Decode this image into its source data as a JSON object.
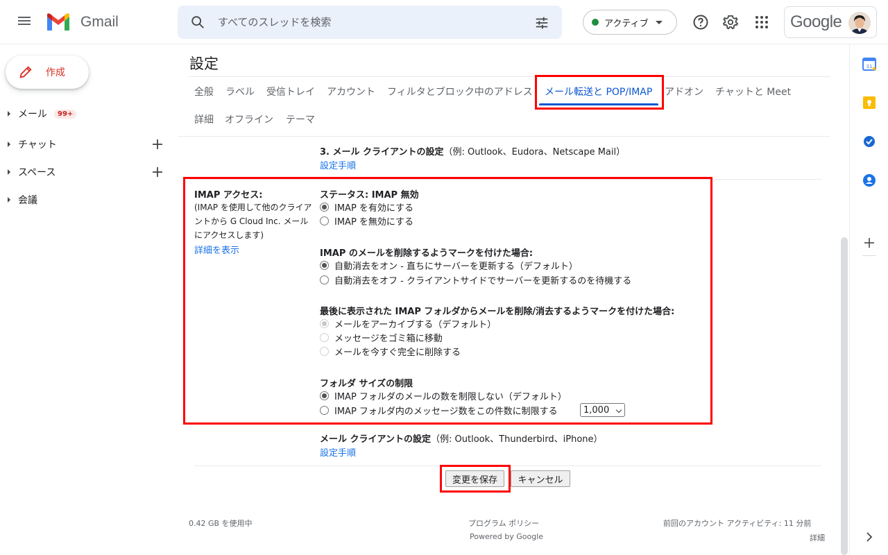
{
  "header": {
    "app_name": "Gmail",
    "search_placeholder": "すべてのスレッドを検索",
    "status_label": "アクティブ",
    "account_brand": "Google"
  },
  "nav": {
    "compose_label": "作成",
    "items": [
      {
        "label": "メール",
        "badge": "99+"
      },
      {
        "label": "チャット"
      },
      {
        "label": "スペース"
      },
      {
        "label": "会議"
      }
    ]
  },
  "settings": {
    "title": "設定",
    "tabs_row1": [
      "全般",
      "ラベル",
      "受信トレイ",
      "アカウント",
      "フィルタとブロック中のアドレス",
      "メール転送と POP/IMAP",
      "アドオン",
      "チャットと Meet"
    ],
    "tabs_row2": [
      "詳細",
      "オフライン",
      "テーマ"
    ],
    "active_tab": "メール転送と POP/IMAP",
    "client_setup": {
      "title_bold": "3. メール クライアントの設定",
      "title_rest": "（例: Outlook、Eudora、Netscape Mail）",
      "link": "設定手順"
    },
    "imap": {
      "label": "IMAP アクセス:",
      "description": "(IMAP を使用して他のクライアントから G Cloud Inc. メール にアクセスします)",
      "details_link": "詳細を表示",
      "status_title": "ステータス: IMAP 無効",
      "status_options": [
        "IMAP を有効にする",
        "IMAP を無効にする"
      ],
      "delete_title": "IMAP のメールを削除するようマークを付けた場合:",
      "delete_options": [
        "自動消去をオン - 直ちにサーバーを更新する（デフォルト）",
        "自動消去をオフ - クライアントサイドでサーバーを更新するのを待機する"
      ],
      "expunge_title": "最後に表示された IMAP フォルダからメールを削除/消去するようマークを付けた場合:",
      "expunge_options": [
        "メールをアーカイブする（デフォルト）",
        "メッセージをゴミ箱に移動",
        "メールを今すぐ完全に削除する"
      ],
      "folder_title": "フォルダ サイズの制限",
      "folder_options": [
        "IMAP フォルダのメールの数を制限しない（デフォルト）",
        "IMAP フォルダ内のメッセージ数をこの件数に制限する"
      ],
      "folder_limit_value": "1,000"
    },
    "client_config": {
      "title_bold": "メール クライアントの設定",
      "title_rest": "（例: Outlook、Thunderbird、iPhone）",
      "link": "設定手順"
    },
    "save_label": "変更を保存",
    "cancel_label": "キャンセル"
  },
  "footer": {
    "storage": "0.42 GB を使用中",
    "policy": "プログラム ポリシー",
    "powered": "Powered by Google",
    "activity": "前回のアカウント アクティビティ: 11 分前",
    "details": "詳細"
  },
  "colors": {
    "accent": "#0b57d0",
    "highlight": "#ff0000",
    "link": "#1a73e8",
    "compose_red": "#d93025"
  }
}
